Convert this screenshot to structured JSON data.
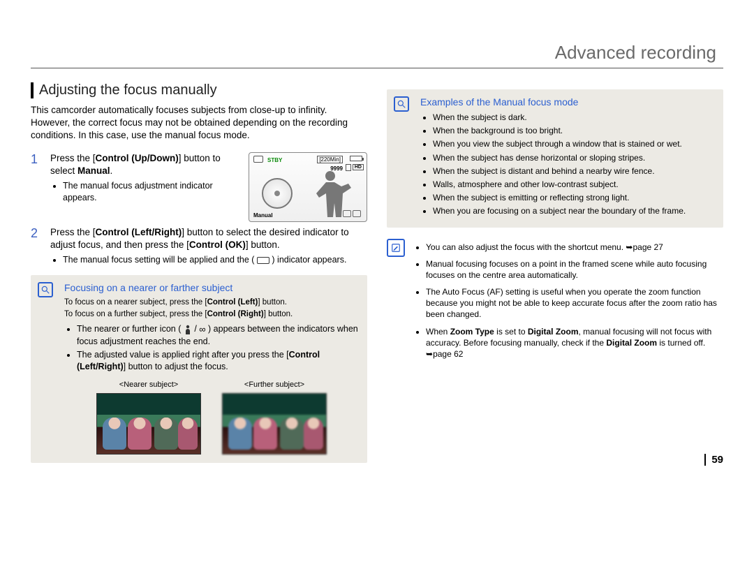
{
  "header": {
    "title": "Advanced recording"
  },
  "page_number": "59",
  "left": {
    "section_title": "Adjusting the focus manually",
    "intro": "This camcorder automatically focuses subjects from close-up to infinity. However, the correct focus may not be obtained depending on the recording conditions. In this case, use the manual focus mode.",
    "step1": {
      "num": "1",
      "line1a": "Press the [",
      "line1b": "Control (Up/Down)",
      "line1c": "] button to select ",
      "line1d": "Manual",
      "line1e": ".",
      "bullet": "The manual focus adjustment indicator appears."
    },
    "step2": {
      "num": "2",
      "line1a": "Press the [",
      "line1b": "Control (Left/Right)",
      "line1c": "] button to select the desired indicator to adjust focus, and then press the [",
      "line1d": "Control (OK)",
      "line1e": "] button.",
      "bullet": "The manual focus setting will be applied and the ( ⧉ ) indicator appears."
    },
    "lcd": {
      "stby": "STBY",
      "time": "[220Min]",
      "count": "9999",
      "hd": "HD",
      "manual": "Manual"
    },
    "info1": {
      "title": "Focusing on a nearer or farther subject",
      "p1a": "To focus on a nearer subject, press the [",
      "p1b": "Control (Left)",
      "p1c": "] button.",
      "p2a": "To focus on a further subject, press the [",
      "p2b": "Control (Right)",
      "p2c": "] button.",
      "b1": "The nearer or further icon ( 🧍 / ∞ ) appears between the indicators when focus adjustment reaches the end.",
      "b2a": "The adjusted value is applied right after you press the [",
      "b2b": "Control (Left/Right)",
      "b2c": "] button to adjust the focus.",
      "thumb_left": "<Nearer subject>",
      "thumb_right": "<Further subject>"
    }
  },
  "right": {
    "info2": {
      "title": "Examples of the Manual focus mode",
      "bullets": [
        "When the subject is dark.",
        "When the background is too bright.",
        "When you view the subject through a window that is stained or wet.",
        "When the subject has dense horizontal or sloping stripes.",
        "When the subject is distant and behind a nearby wire fence.",
        "Walls, atmosphere and other low-contrast subject.",
        "When the subject is emitting or reflecting strong light.",
        "When you are focusing on a subject near the boundary of the frame."
      ]
    },
    "notes": {
      "n1a": "You can also adjust the focus with the shortcut menu. ",
      "n1b": "page 27",
      "n2": "Manual focusing focuses on a point in the framed scene while auto focusing focuses on the centre area automatically.",
      "n3": "The Auto Focus (AF) setting is useful when you operate the zoom function because you might not be able to keep accurate focus after the zoom ratio has been changed.",
      "n4a": "When ",
      "n4b": "Zoom Type",
      "n4c": " is set to ",
      "n4d": "Digital Zoom",
      "n4e": ", manual focusing will not focus with accuracy. Before focusing manually, check if the ",
      "n4f": "Digital Zoom",
      "n4g": " is turned off. ",
      "n4h": "page 62"
    }
  }
}
